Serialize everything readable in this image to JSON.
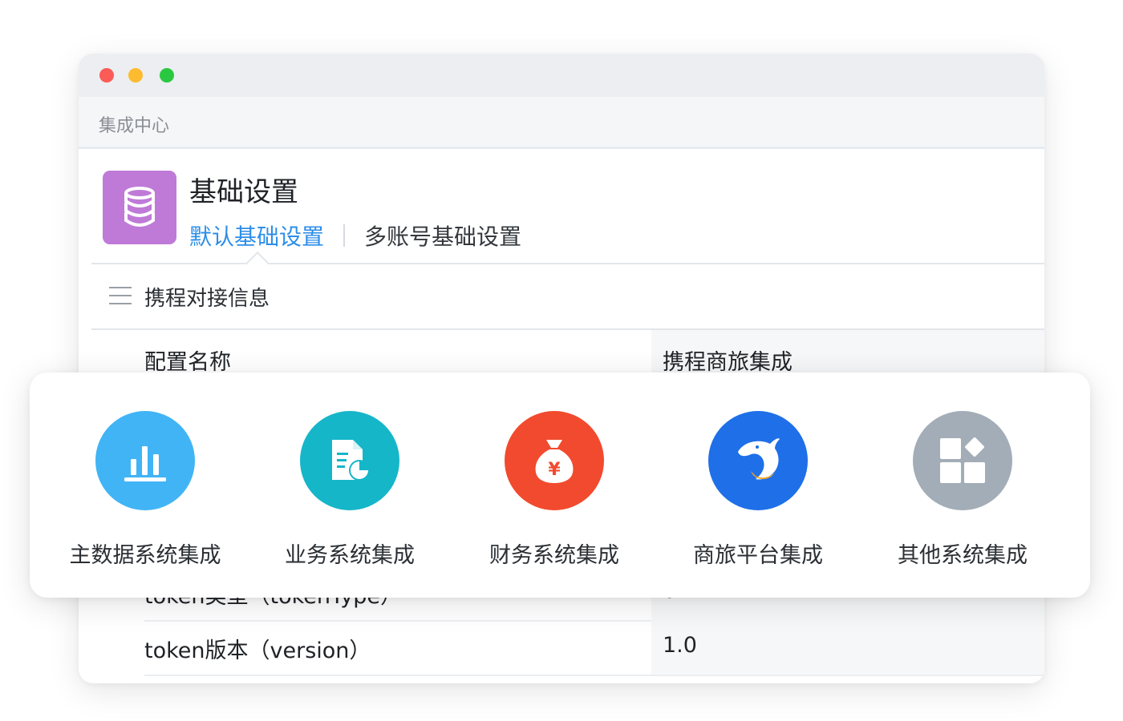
{
  "window": {
    "app_title": "集成中心",
    "traffic_lights": [
      "#fd5b56",
      "#fdbb30",
      "#2ac840"
    ]
  },
  "module": {
    "icon": "database-icon",
    "icon_color": "#bf7ad8",
    "title": "基础设置",
    "tabs": [
      {
        "label": "默认基础设置",
        "active": true
      },
      {
        "label": "多账号基础设置",
        "active": false
      }
    ]
  },
  "section": {
    "title": "携程对接信息",
    "icon": "menu-icon"
  },
  "table": {
    "rows": [
      {
        "name": "配置名称",
        "value": "携程商旅集成"
      },
      {
        "name": "token类型（tokenType）",
        "value": "0"
      },
      {
        "name": "token版本（version）",
        "value": "1.0"
      }
    ]
  },
  "integrations": [
    {
      "label": "主数据系统集成",
      "icon": "bar-chart-icon",
      "color": "#41b4f5"
    },
    {
      "label": "业务系统集成",
      "icon": "document-chart-icon",
      "color": "#16b6c9"
    },
    {
      "label": "财务系统集成",
      "icon": "money-bag-icon",
      "color": "#f24a2e"
    },
    {
      "label": "商旅平台集成",
      "icon": "dolphin-icon",
      "color": "#1f6fe8"
    },
    {
      "label": "其他系统集成",
      "icon": "apps-icon",
      "color": "#a3adb7"
    }
  ],
  "accent_color": "#2d8ee8"
}
